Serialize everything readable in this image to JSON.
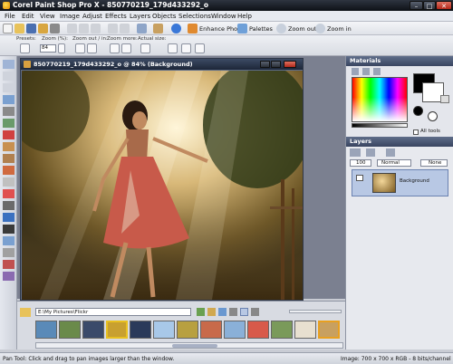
{
  "window": {
    "title": "Corel Paint Shop Pro X - 850770219_179d433292_o"
  },
  "menus": [
    "File",
    "Edit",
    "View",
    "Image",
    "Adjust",
    "Effects",
    "Layers",
    "Objects",
    "Selections",
    "Window",
    "Help"
  ],
  "toolbar": {
    "enhance_photo": "Enhance Photo",
    "palettes": "Palettes",
    "zoom_out": "Zoom out",
    "zoom_in": "Zoom in"
  },
  "options_bar": {
    "presets_label": "Presets:",
    "zoom_label": "Zoom (%):",
    "zoom_value": "84",
    "zoom_out_in_label": "Zoom out / in:",
    "zoom_more_label": "Zoom more:",
    "actual_size_label": "Actual size:"
  },
  "image_window": {
    "title": "850770219_179d433292_o @ 84% (Background)"
  },
  "materials": {
    "title": "Materials",
    "all_tools_label": "All tools",
    "foreground": "#000000",
    "background": "#ffffff"
  },
  "layers": {
    "title": "Layers",
    "opacity": "100",
    "blend_mode": "Normal",
    "lock_mode": "None",
    "items": [
      {
        "name": "Background"
      }
    ]
  },
  "browser": {
    "path": "E:\\My Pictures\\Flickr",
    "thumbnail_count": 15
  },
  "status": {
    "tool_hint": "Pan Tool: Click and drag to pan images larger than the window.",
    "image_info": "Image: 700 x 700 x RGB - 8 bits/channel"
  }
}
